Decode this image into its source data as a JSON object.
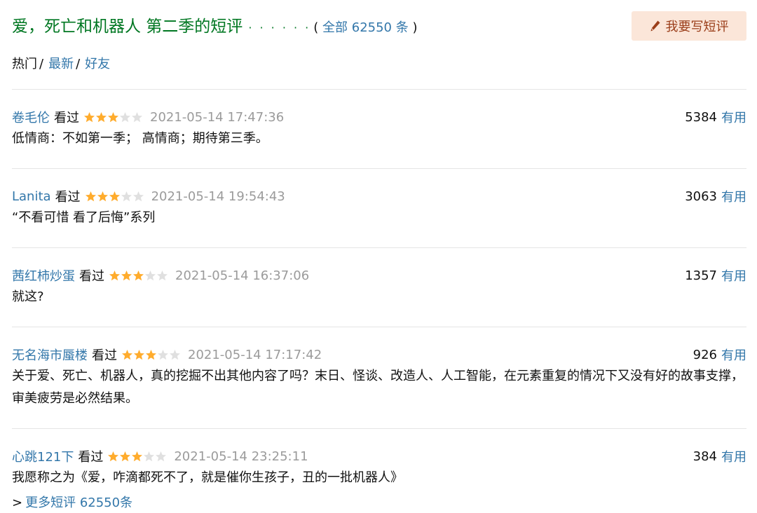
{
  "header": {
    "title": "爱，死亡和机器人 第二季的短评",
    "dots": "· · · · · ·",
    "total_open": "(",
    "total_link": "全部 62550 条",
    "total_close": ")",
    "write_button": "我要写短评"
  },
  "tabs": {
    "hot": "热门",
    "sep1": "/",
    "latest": "最新",
    "sep2": "/",
    "friends": "好友"
  },
  "comments": [
    {
      "user": "卷毛伦",
      "status": "看过",
      "rating": 3,
      "time": "2021-05-14 17:47:36",
      "votes": "5384",
      "useful": "有用",
      "content": "低情商：不如第一季； 高情商；期待第三季。"
    },
    {
      "user": "Lanita",
      "status": "看过",
      "rating": 3,
      "time": "2021-05-14 19:54:43",
      "votes": "3063",
      "useful": "有用",
      "content": "“不看可惜 看了后悔”系列"
    },
    {
      "user": "茜红柿炒蛋",
      "status": "看过",
      "rating": 3,
      "time": "2021-05-14 16:37:06",
      "votes": "1357",
      "useful": "有用",
      "content": "就这?"
    },
    {
      "user": "无名海市蜃楼",
      "status": "看过",
      "rating": 3,
      "time": "2021-05-14 17:17:42",
      "votes": "926",
      "useful": "有用",
      "content": "关于爱、死亡、机器人，真的挖掘不出其他内容了吗？末日、怪谈、改造人、人工智能，在元素重复的情况下又没有好的故事支撑，审美疲劳是必然结果。"
    },
    {
      "user": "心跳121下",
      "status": "看过",
      "rating": 3,
      "time": "2021-05-14 23:25:11",
      "votes": "384",
      "useful": "有用",
      "content": "我愿称之为《爱，咋滴都死不了，就是催你生孩子，丑的一批机器人》"
    }
  ],
  "more": {
    "arrow": ">",
    "link": "更多短评 62550条"
  },
  "colors": {
    "title_green": "#007722",
    "link_blue": "#3377aa",
    "star_on": "#ffac2d",
    "star_off": "#e0e0e0",
    "button_bg": "#fbe6d9",
    "time_gray": "#9b9b9b"
  },
  "icons": {
    "write": "pencil-icon",
    "star_filled": "star-filled-icon",
    "star_empty": "star-empty-icon"
  }
}
